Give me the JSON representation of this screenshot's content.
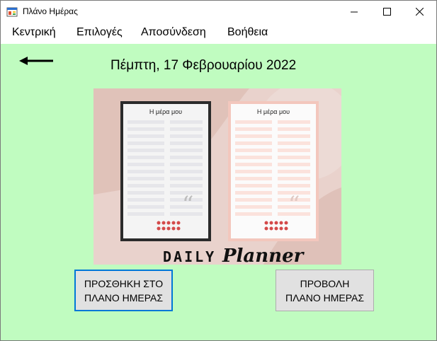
{
  "window": {
    "title": "Πλάνο Ημέρας"
  },
  "menu": {
    "items": [
      "Κεντρική",
      "Επιλογές",
      "Αποσύνδεση",
      "Βοήθεια"
    ]
  },
  "main": {
    "date": "Πέμπτη, 17 Φεβρουαρίου 2022",
    "planner_image": {
      "page_title": "Η μέρα μου",
      "brand_text": "DAILY",
      "brand_script": "Planner"
    },
    "buttons": {
      "add": [
        "ΠΡΟΣΘΗΚΗ ΣΤΟ",
        "ΠΛΑΝΟ ΗΜΕΡΑΣ"
      ],
      "view": [
        "ΠΡΟΒΟΛΗ",
        "ΠΛΑΝΟ ΗΜΕΡΑΣ"
      ]
    }
  },
  "colors": {
    "background": "#c0fcc0",
    "focus_border": "#0078d7",
    "button_face": "#e1e1e1"
  }
}
